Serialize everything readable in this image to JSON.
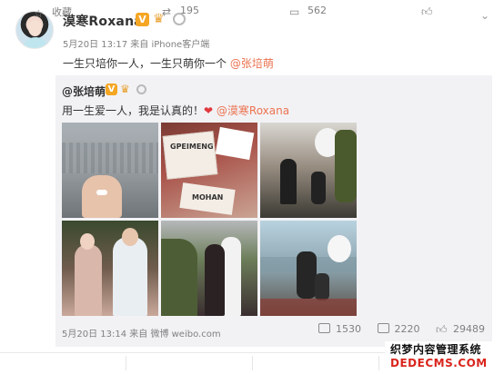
{
  "post": {
    "username": "漠寒Roxana",
    "v_badge": "V",
    "meta": "5月20日 13:17 来自 iPhone客户端",
    "text_main": "一生只培你一人，一生只萌你一个 ",
    "text_mention": "@张培萌"
  },
  "repost": {
    "username": "@张培萌",
    "v_badge": "V",
    "text_main": "用一生爱一人，我是认真的！",
    "heart": "❤",
    "text_mention": "@漠寒Roxana",
    "photo_labels": {
      "p2_card_line1": "GPEIMENG",
      "p2_card_line2": "MOHAN"
    },
    "meta": "5月20日 13:14 来自 微博 weibo.com",
    "stats": [
      {
        "icon": "repost-icon",
        "value": "1530"
      },
      {
        "icon": "comment-icon",
        "value": "2220"
      },
      {
        "icon": "like-icon",
        "value": "29489"
      }
    ]
  },
  "actions": [
    {
      "icon": "star-icon",
      "label": "收藏"
    },
    {
      "icon": "repost-icon",
      "label": "195"
    },
    {
      "icon": "comment-icon",
      "label": "562"
    },
    {
      "icon": "like-icon",
      "label": ""
    }
  ],
  "watermark": {
    "line1": "织梦内容管理系统",
    "line2": "DEDECMS.COM"
  },
  "colors": {
    "mention": "#eb7350",
    "repost_bg": "#f2f2f5",
    "badge": "#f5a623"
  }
}
